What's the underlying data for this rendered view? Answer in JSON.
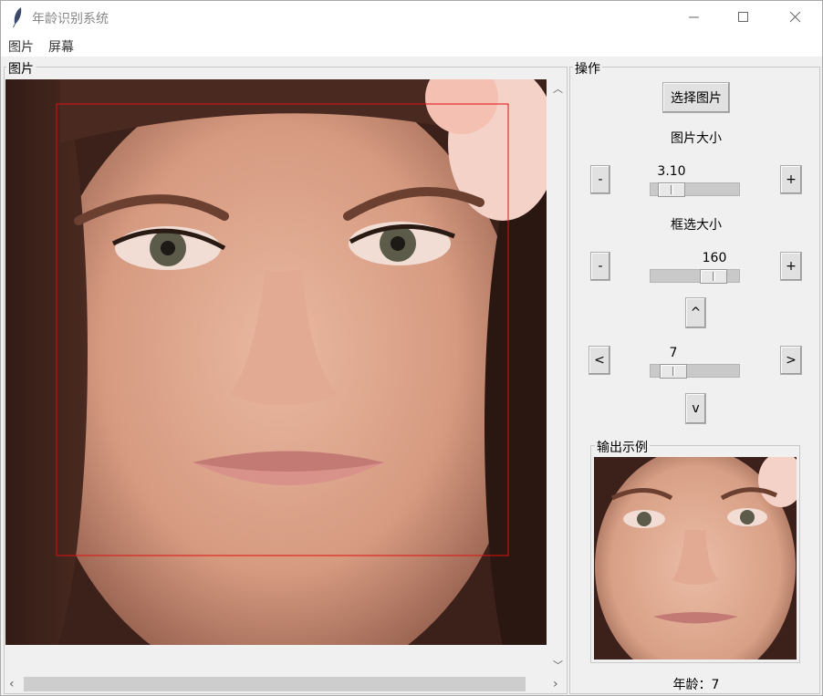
{
  "window": {
    "title": "年龄识别系统"
  },
  "menu": [
    "图片",
    "屏幕"
  ],
  "image_frame": {
    "label": "图片"
  },
  "ops_frame": {
    "label": "操作",
    "select_button": "选择图片",
    "image_size": {
      "label": "图片大小",
      "value": "3.10",
      "minus": "-",
      "plus": "+"
    },
    "box_size": {
      "label": "框选大小",
      "value": "160",
      "minus": "-",
      "plus": "+"
    },
    "nav": {
      "up": "^",
      "left": "<",
      "right": ">",
      "down": "v",
      "value": "7"
    },
    "output": {
      "label": "输出示例",
      "age_text": "年龄：7"
    }
  },
  "colors": {
    "selection_box": "#e01010",
    "title_text": "#888888"
  }
}
